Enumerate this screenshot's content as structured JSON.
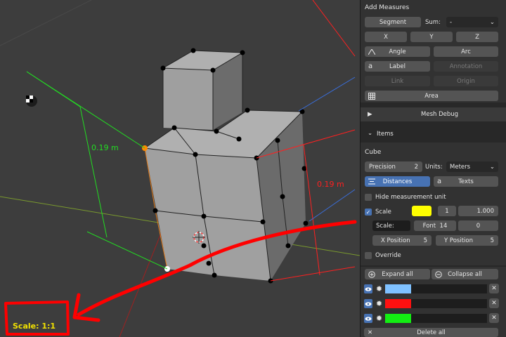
{
  "viewport": {
    "dimensions": [
      {
        "text": "0.19 m",
        "color": "#22dd22"
      },
      {
        "text": "0.19 m",
        "color": "#ff2020"
      }
    ],
    "scale_readout": "Scale: 1:1",
    "scale_readout_color": "#f2e200",
    "annotation_color": "#ff0000"
  },
  "add_measures": {
    "title": "Add Measures",
    "segment": "Segment",
    "sum_label": "Sum:",
    "sum_value": "-",
    "x": "X",
    "y": "Y",
    "z": "Z",
    "angle": "Angle",
    "arc": "Arc",
    "label": "Label",
    "annotation": "Annotation",
    "link": "Link",
    "origin": "Origin",
    "area": "Area"
  },
  "mesh_debug": "Mesh Debug",
  "items_header": "Items",
  "item": {
    "name": "Cube",
    "precision_label": "Precision",
    "precision_value": "2",
    "units_label": "Units:",
    "units_value": "Meters",
    "distances": "Distances",
    "texts": "Texts",
    "hide_unit": "Hide measurement unit",
    "scale_label": "Scale",
    "scale_color": "#ffff00",
    "scale_num": "1",
    "scale_factor": "1.000",
    "scale_text": "Scale:",
    "font_label": "Font",
    "font_value": "14",
    "angle_value": "0",
    "xpos_label": "X Position",
    "xpos_value": "5",
    "ypos_label": "Y Position",
    "ypos_value": "5",
    "override": "Override"
  },
  "list": {
    "expand_all": "Expand all",
    "collapse_all": "Collapse all",
    "rows": [
      {
        "color": "#7fc1ff"
      },
      {
        "color": "#ff1010"
      },
      {
        "color": "#13ee13"
      }
    ],
    "delete_all": "Delete all"
  }
}
